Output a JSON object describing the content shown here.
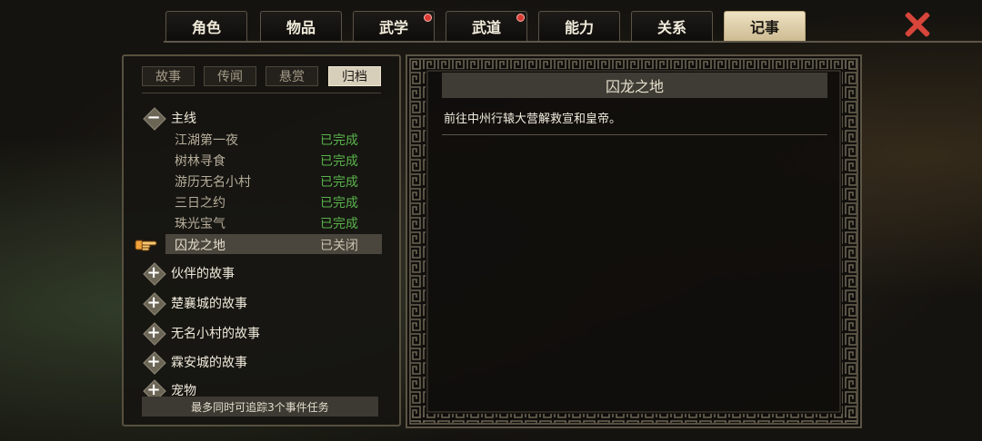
{
  "tabs": [
    {
      "label": "角色",
      "active": false,
      "alert": false
    },
    {
      "label": "物品",
      "active": false,
      "alert": false
    },
    {
      "label": "武学",
      "active": false,
      "alert": true
    },
    {
      "label": "武道",
      "active": false,
      "alert": true
    },
    {
      "label": "能力",
      "active": false,
      "alert": false
    },
    {
      "label": "关系",
      "active": false,
      "alert": false
    },
    {
      "label": "记事",
      "active": true,
      "alert": false
    }
  ],
  "subtabs": [
    {
      "label": "故事",
      "active": false
    },
    {
      "label": "传闻",
      "active": false
    },
    {
      "label": "悬赏",
      "active": false
    },
    {
      "label": "归档",
      "active": true
    }
  ],
  "main_group": {
    "label": "主线",
    "expanded_symbol": "−",
    "quests": [
      {
        "name": "江湖第一夜",
        "status": "已完成",
        "selected": false
      },
      {
        "name": "树林寻食",
        "status": "已完成",
        "selected": false
      },
      {
        "name": "游历无名小村",
        "status": "已完成",
        "selected": false
      },
      {
        "name": "三日之约",
        "status": "已完成",
        "selected": false
      },
      {
        "name": "珠光宝气",
        "status": "已完成",
        "selected": false
      },
      {
        "name": "囚龙之地",
        "status": "已关闭",
        "selected": true
      }
    ]
  },
  "collapsed_groups": [
    {
      "label": "伙伴的故事",
      "symbol": "+"
    },
    {
      "label": "楚襄城的故事",
      "symbol": "+"
    },
    {
      "label": "无名小村的故事",
      "symbol": "+"
    },
    {
      "label": "霖安城的故事",
      "symbol": "+"
    },
    {
      "label": "宠物",
      "symbol": "+"
    }
  ],
  "footer_text": "最多同时可追踪3个事件任务",
  "detail": {
    "title": "囚龙之地",
    "description": "前往中州行辕大营解救宣和皇帝。"
  },
  "icons": {
    "close": "close-x-icon",
    "pointer": "pointing-hand-icon",
    "expand": "plus-diamond-icon",
    "collapse": "minus-diamond-icon"
  },
  "colors": {
    "active_tab": "#e6d8b6",
    "completed": "#59b34a",
    "alert_dot": "#d83c36",
    "close": "#d8453a"
  }
}
